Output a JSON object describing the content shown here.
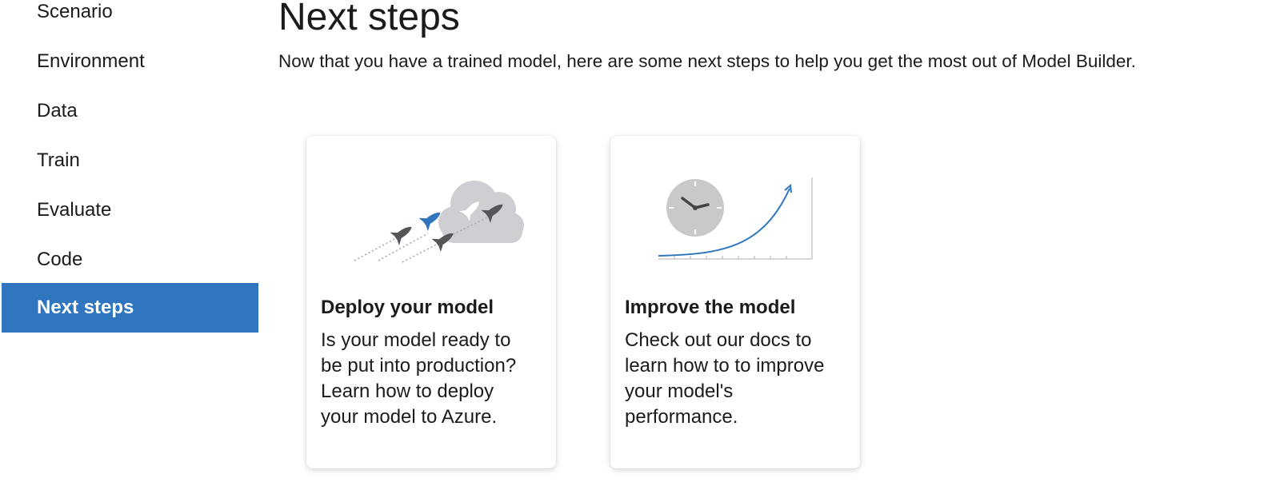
{
  "sidebar": {
    "items": [
      {
        "label": "Scenario",
        "active": false
      },
      {
        "label": "Environment",
        "active": false
      },
      {
        "label": "Data",
        "active": false
      },
      {
        "label": "Train",
        "active": false
      },
      {
        "label": "Evaluate",
        "active": false
      },
      {
        "label": "Code",
        "active": false
      },
      {
        "label": "Next steps",
        "active": true
      }
    ],
    "active_color": "#2f76bf"
  },
  "main": {
    "title": "Next steps",
    "subtitle": "Now that you have a trained model, here are some next steps to help you get the most out of Model Builder.",
    "cards": [
      {
        "title": "Deploy your model",
        "description": "Is your model ready to\nbe put into production?\nLearn how to deploy\nyour model to Azure.",
        "icon": "rocket-cloud-icon"
      },
      {
        "title": "Improve the model",
        "description": "Check out our docs to\nlearn how to to improve\nyour model's\nperformance.",
        "icon": "clock-growth-chart-icon"
      }
    ]
  }
}
